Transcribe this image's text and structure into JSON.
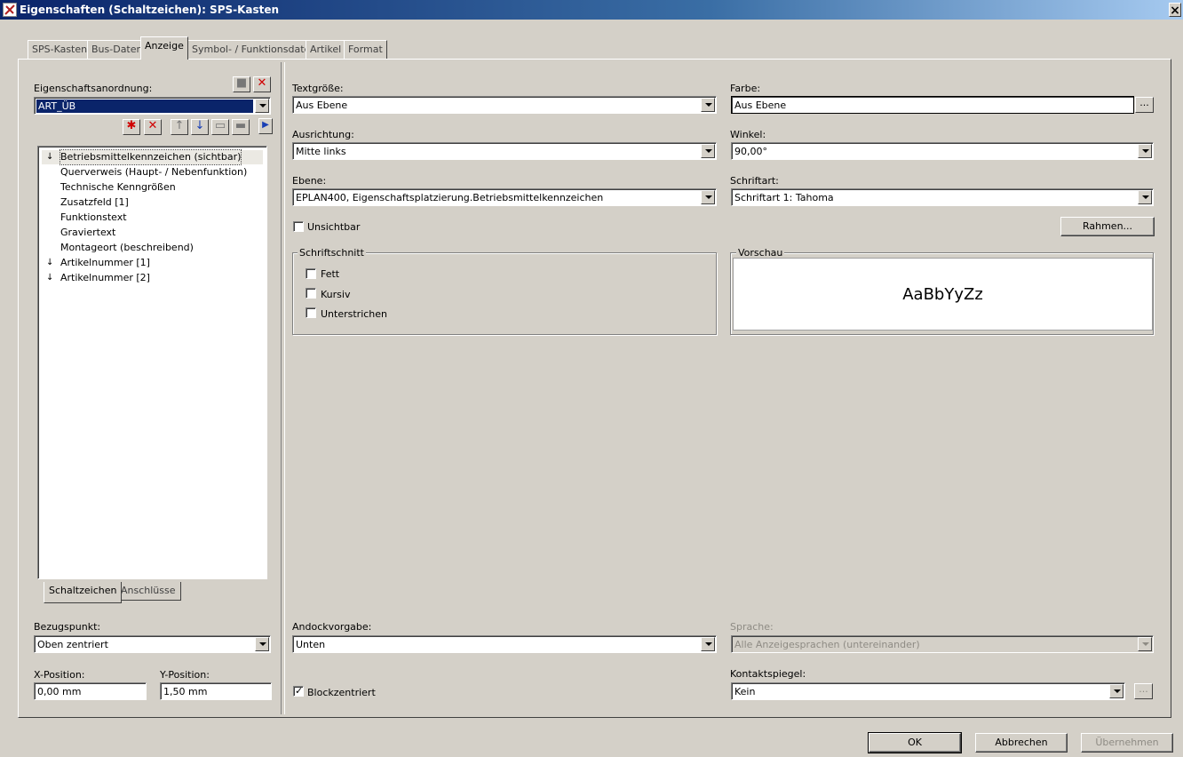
{
  "window": {
    "title": "Eigenschaften (Schaltzeichen): SPS-Kasten",
    "close_label": "×"
  },
  "tabs": [
    {
      "label": "SPS-Kasten"
    },
    {
      "label": "Bus-Daten"
    },
    {
      "label": "Anzeige",
      "active": true
    },
    {
      "label": "Symbol- / Funktionsdaten"
    },
    {
      "label": "Artikel"
    },
    {
      "label": "Format"
    }
  ],
  "left": {
    "arrangement_label": "Eigenschaftsanordnung:",
    "arrangement_value": "ART_ÜB",
    "tree_items": [
      {
        "label": "Betriebsmittelkennzeichen (sichtbar)",
        "sort_icon": "↓",
        "selected": true
      },
      {
        "label": "Querverweis (Haupt- / Nebenfunktion)",
        "sort_icon": ""
      },
      {
        "label": "Technische Kenngrößen",
        "sort_icon": ""
      },
      {
        "label": "Zusatzfeld [1]",
        "sort_icon": ""
      },
      {
        "label": "Funktionstext",
        "sort_icon": ""
      },
      {
        "label": "Graviertext",
        "sort_icon": ""
      },
      {
        "label": "Montageort (beschreibend)",
        "sort_icon": ""
      },
      {
        "label": "Artikelnummer [1]",
        "sort_icon": "↓"
      },
      {
        "label": "Artikelnummer [2]",
        "sort_icon": "↓"
      }
    ],
    "bottom_tabs": [
      {
        "label": "Schaltzeichen",
        "active": true
      },
      {
        "label": "Anschlüsse"
      }
    ],
    "reference_label": "Bezugspunkt:",
    "reference_value": "Oben zentriert",
    "x_label": "X-Position:",
    "x_value": "0,00 mm",
    "y_label": "Y-Position:",
    "y_value": "1,50 mm"
  },
  "right": {
    "text_size_label": "Textgröße:",
    "text_size_value": "Aus Ebene",
    "color_label": "Farbe:",
    "color_value": "Aus Ebene",
    "alignment_label": "Ausrichtung:",
    "alignment_value": "Mitte links",
    "angle_label": "Winkel:",
    "angle_value": "90,00°",
    "layer_label": "Ebene:",
    "layer_value": "EPLAN400, Eigenschaftsplatzierung.Betriebsmittelkennzeichen",
    "font_label": "Schriftart:",
    "font_value": "Schriftart 1: Tahoma",
    "invisible_label": "Unsichtbar",
    "invisible_checked": false,
    "frame_button": "Rahmen...",
    "font_style_group": "Schriftschnitt",
    "bold_label": "Fett",
    "bold_checked": false,
    "italic_label": "Kursiv",
    "italic_checked": false,
    "underline_label": "Unterstrichen",
    "underline_checked": false,
    "preview_group": "Vorschau",
    "preview_text": "AaBbYyZz",
    "dock_label": "Andockvorgabe:",
    "dock_value": "Unten",
    "language_label": "Sprache:",
    "language_value": "Alle Anzeigesprachen (untereinander)",
    "block_centered_label": "Blockzentriert",
    "block_centered_checked": true,
    "contact_mirror_label": "Kontaktspiegel:",
    "contact_mirror_value": "Kein",
    "dots_label": "..."
  },
  "footer": {
    "ok": "OK",
    "cancel": "Abbrechen",
    "apply": "Übernehmen"
  }
}
